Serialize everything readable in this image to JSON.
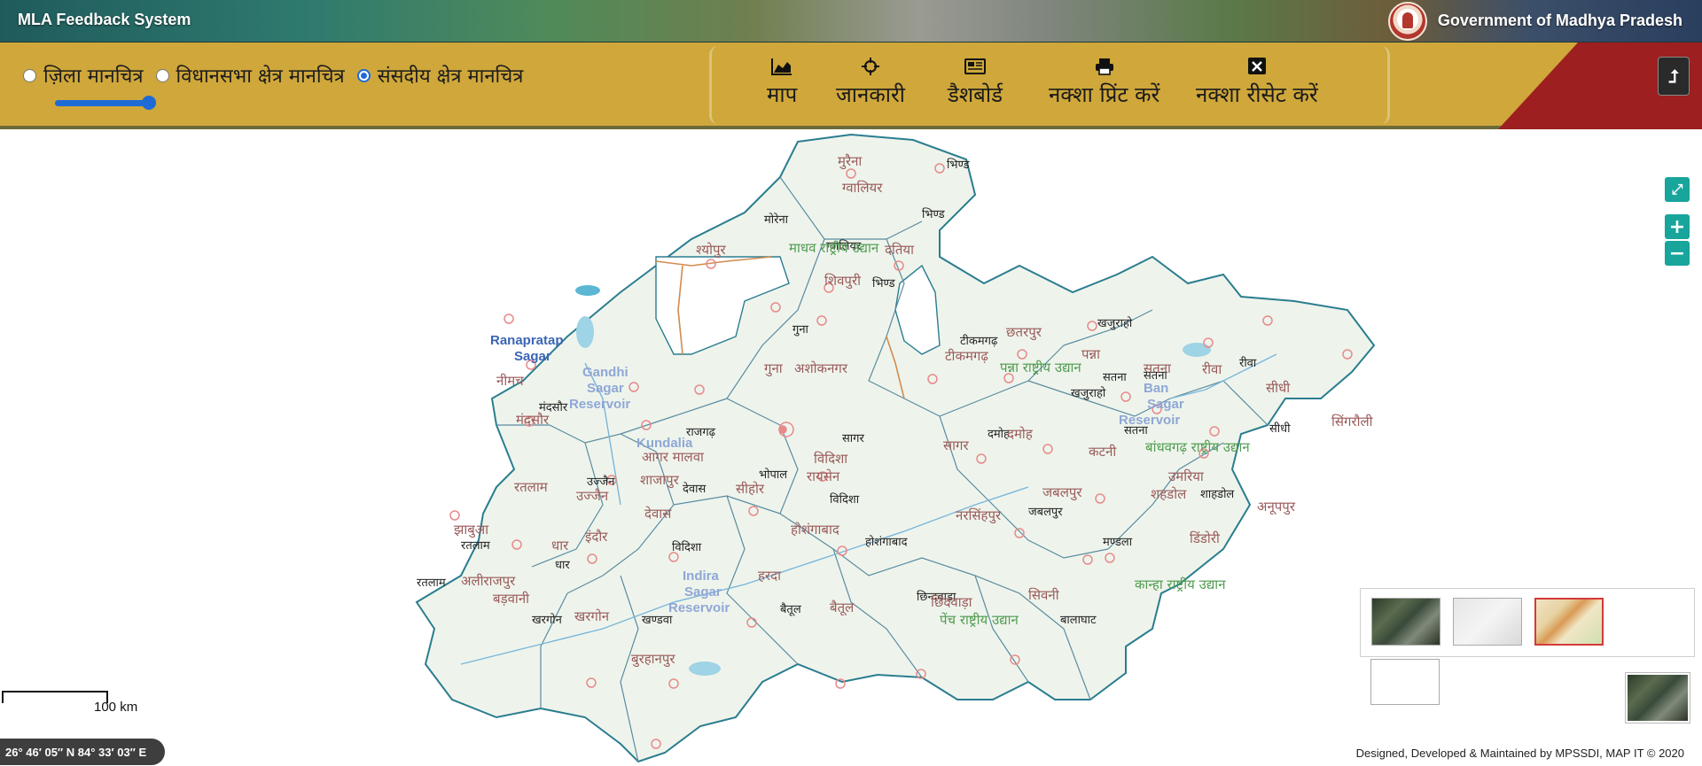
{
  "header": {
    "app_title": "MLA Feedback System",
    "gov_title": "Government of Madhya Pradesh"
  },
  "toolbar": {
    "radios": [
      {
        "label": "ज़िला मानचित्र",
        "checked": false
      },
      {
        "label": "विधानसभा क्षेत्र मानचित्र",
        "checked": false
      },
      {
        "label": "संसदीय क्षेत्र मानचित्र",
        "checked": true
      }
    ],
    "tools": [
      {
        "label": "माप",
        "icon": "area-chart-icon"
      },
      {
        "label": "जानकारी",
        "icon": "crosshair-icon"
      },
      {
        "label": "डैशबोर्ड",
        "icon": "dashboard-icon"
      },
      {
        "label": "नक्शा प्रिंट करें",
        "icon": "print-icon"
      },
      {
        "label": "नक्शा रीसेट करें",
        "icon": "reset-x-icon"
      }
    ],
    "upload_icon": "upload-arrow-icon"
  },
  "map": {
    "scale_label": "100 km",
    "coordinates": "26° 46′ 05″ N 84° 33′ 03″ E",
    "labels": {
      "morena": "मुरैना",
      "morena2": "मोरेना",
      "bhind": "भिण्ड",
      "bhind2": "भिण्ड",
      "gwalior": "ग्वालियर",
      "gwalior2": "ग्वालियर",
      "sheopur": "श्योपुर",
      "datia": "दतिया",
      "shivpuri": "शिवपुरी",
      "bhinda": "भिण्ड",
      "guna": "गुना",
      "guna2": "गुना",
      "ashoknagar": "अशोकनगर",
      "tikamgarh": "टीकमगढ़",
      "tikamgarh2": "टीकमगढ़",
      "chhatarpur": "छतरपुर",
      "khajuraho": "खजुराहो",
      "khajuraho2": "खजुराहो",
      "panna": "पन्ना",
      "satna": "सतना",
      "satna2": "सतना",
      "satna3": "सतना",
      "rewa": "रीवा",
      "rewa2": "रीवा",
      "sidhi": "सीधी",
      "sidhi2": "सीधी",
      "singrauli": "सिंगरौली",
      "neemuch": "नीमच",
      "mandsaur": "मंदसौर",
      "mandsaur2": "मंदसौर",
      "ratlam": "रतलाम",
      "ratlam2": "रतलाम",
      "ratlam3": "रतलाम",
      "ujjain": "उज्जैन",
      "ujjain2": "उज्जैन",
      "rajgarh": "राजगढ़",
      "agar_malwa": "आगर मालवा",
      "shajapur": "शाजापुर",
      "dewas": "देवास",
      "dewas2": "देवास",
      "bhopal": "भोपाल",
      "sehore": "सीहोर",
      "vidisha": "विदिशा",
      "vidisha2": "विदिशा",
      "vidisha3": "विदिशा",
      "raisen": "रायसेन",
      "sagar": "सागर",
      "sagar2": "सागर",
      "damoh": "दमोह",
      "katni": "कटनी",
      "umaria": "उमरिया",
      "shahdol": "शहडोल",
      "shahdol2": "शाहडोल",
      "anuppur": "अनूपपुर",
      "jabalpur": "जबलपुर",
      "jabalpur2": "जबलपुर",
      "narsinghpur": "नरसिंहपुर",
      "dindori": "डिंडोरी",
      "mandla": "मण्डला",
      "jhabua": "झाबुआ",
      "dhar": "धार",
      "dhar2": "धार",
      "indore": "इंदौर",
      "alirajpur": "अलीराजपुर",
      "barwani": "बड़वानी",
      "khargone": "खरगोन",
      "khargone2": "खरगोन",
      "khandwa": "खण्डवा",
      "burhanpur": "बुरहानपुर",
      "harda": "हरदा",
      "hoshangabad": "होशंगाबाद",
      "hoshangabad2": "होशंगाबाद",
      "betul": "बैतूल",
      "betul2": "बैतूल",
      "chhindwara": "छिन्दवाड़ा",
      "chhindwara2": "छिंदवाड़ा",
      "seoni": "सिवनी",
      "balaghat": "बालाघाट",
      "ranapratap": "Ranapratap",
      "sagar_en": "Sagar",
      "gandhi": "Gandhi",
      "sagar_en2": "Sagar",
      "reservoir": "Reservoir",
      "kundalia": "Kundalia",
      "ban": "Ban",
      "sagar_en3": "Sagar",
      "reservoir2": "Reservoir",
      "indira": "Indira",
      "sagar_en4": "Sagar",
      "reservoir3": "Reservoir",
      "national_park1": "माधव राष्ट्रीय उद्यान",
      "national_park2": "पन्ना राष्ट्रीय उद्यान",
      "national_park3": "बांधवगढ़ राष्ट्रीय उद्यान",
      "national_park4": "कान्हा राष्ट्रीय उद्यान",
      "national_park5": "पेंच राष्ट्रीय उद्यान"
    }
  },
  "footer": {
    "credit": "Designed, Developed & Maintained by MPSSDI, MAP IT © 2020"
  },
  "colors": {
    "toolbar_gold": "#cfa73a",
    "accent_red": "#9e1f1f",
    "zoom_teal": "#17a59c",
    "radio_blue": "#1e6bd6"
  }
}
